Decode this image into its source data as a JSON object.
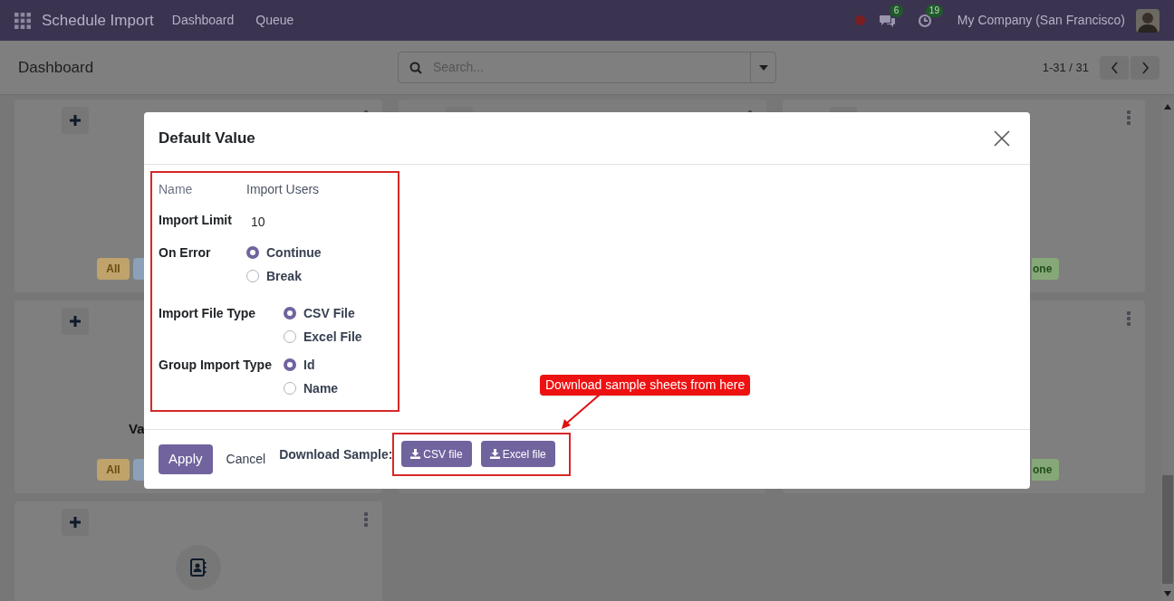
{
  "navbar": {
    "app_title": "Schedule Import",
    "menu": [
      {
        "label": "Dashboard"
      },
      {
        "label": "Queue"
      }
    ],
    "messages_count": "6",
    "activities_count": "19",
    "company": "My Company (San Francisco)"
  },
  "control_panel": {
    "title": "Dashboard",
    "search": {
      "placeholder": "Search..."
    },
    "pager": "1-31 / 31"
  },
  "cards": [
    {
      "badges": [
        {
          "label": "All",
          "color": "#bfa36b"
        },
        {
          "color": "#8ca0b8"
        }
      ]
    },
    {
      "kind": "plain"
    },
    {
      "badges": [
        {
          "label": "one",
          "color": "#86a878"
        }
      ]
    },
    {
      "title": "Va",
      "badges": [
        {
          "label": "All",
          "color": "#bfa36b"
        },
        {
          "color": "#8ca0b8"
        }
      ]
    },
    {
      "kind": "plain"
    },
    {
      "badges": [
        {
          "label": "one",
          "color": "#86a878"
        }
      ]
    },
    {
      "kind": "contact"
    }
  ],
  "dialog": {
    "title": "Default Value",
    "groups": [
      [
        {
          "label": "Name",
          "kind": "readonly",
          "value": "Import Users"
        },
        {
          "label": "Import Limit",
          "kind": "number",
          "value": "10"
        },
        {
          "label": "On Error",
          "kind": "radio",
          "options": [
            {
              "label": "Continue",
              "selected": true
            },
            {
              "label": "Break",
              "selected": false
            }
          ]
        }
      ],
      [
        {
          "label": "Import File Type",
          "kind": "radio",
          "options": [
            {
              "label": "CSV File",
              "selected": true
            },
            {
              "label": "Excel File",
              "selected": false
            }
          ]
        },
        {
          "label": "Group Import Type",
          "kind": "radio",
          "options": [
            {
              "label": "Id",
              "selected": true
            },
            {
              "label": "Name",
              "selected": false
            }
          ]
        }
      ]
    ],
    "footer": {
      "apply": "Apply",
      "cancel": "Cancel",
      "download_label": "Download Sample:",
      "downloads": [
        {
          "label": "CSV file"
        },
        {
          "label": "Excel file"
        }
      ]
    }
  },
  "annotation": {
    "callout": "Download sample sheets from here"
  }
}
